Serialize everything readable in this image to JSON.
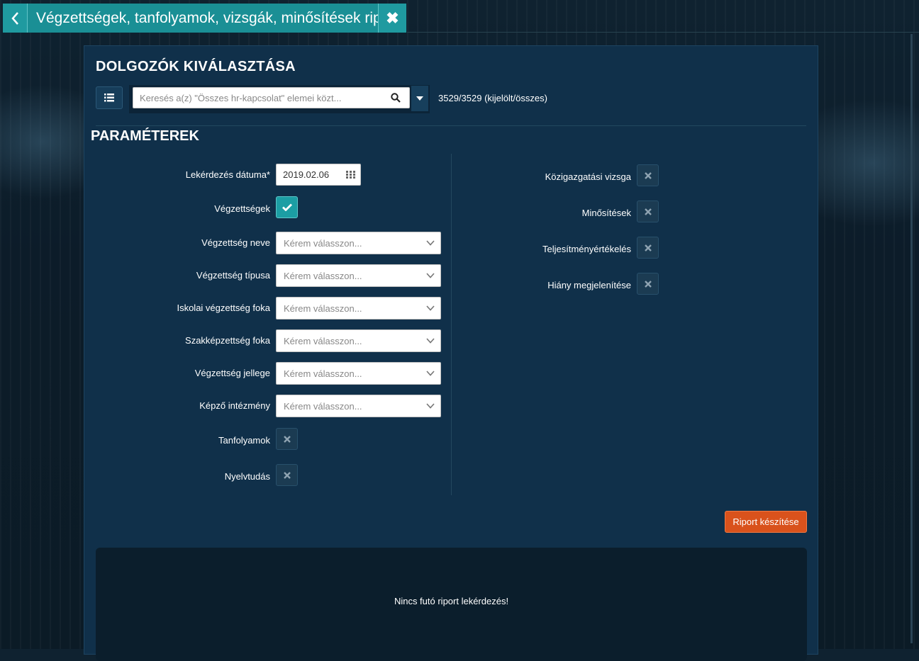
{
  "header": {
    "title": "Végzettségek, tanfolyamok, vizsgák, minősítések riport",
    "back_icon": "chevron-left-icon",
    "close_icon": "close-icon"
  },
  "employee_selection": {
    "heading": "DOLGOZÓK KIVÁLASZTÁSA",
    "search_placeholder": "Keresés a(z) \"Összes hr-kapcsolat\" elemei közt...",
    "count_text": "3529/3529 (kijelölt/összes)"
  },
  "parameters": {
    "heading": "PARAMÉTEREK",
    "date_label": "Lekérdezés dátuma*",
    "date_value": "2019.02.06",
    "vegzettsegek_label": "Végzettségek",
    "vegzettsegek_checked": true,
    "select_placeholder": "Kérem válasszon...",
    "selects": [
      {
        "label": "Végzettség neve",
        "value": "Kérem válasszon..."
      },
      {
        "label": "Végzettség típusa",
        "value": "Kérem válasszon..."
      },
      {
        "label": "Iskolai végzettség foka",
        "value": "Kérem válasszon..."
      },
      {
        "label": "Szakképzettség foka",
        "value": "Kérem válasszon..."
      },
      {
        "label": "Végzettség jellege",
        "value": "Kérem válasszon..."
      },
      {
        "label": "Képző intézmény",
        "value": "Kérem válasszon..."
      }
    ],
    "tanfolyamok_label": "Tanfolyamok",
    "nyelvtudas_label": "Nyelvtudás",
    "right_toggles": [
      {
        "label": "Közigazgatási vizsga",
        "checked": false
      },
      {
        "label": "Minősítések",
        "checked": false
      },
      {
        "label": "Teljesítményértékelés",
        "checked": false
      },
      {
        "label": "Hiány megjelenítése",
        "checked": false
      }
    ]
  },
  "actions": {
    "report_button": "Riport készítése"
  },
  "result": {
    "message": "Nincs futó riport lekérdezés!"
  },
  "colors": {
    "accent": "#1c9ea4",
    "report_button": "#d9521c",
    "panel": "#10304a"
  }
}
